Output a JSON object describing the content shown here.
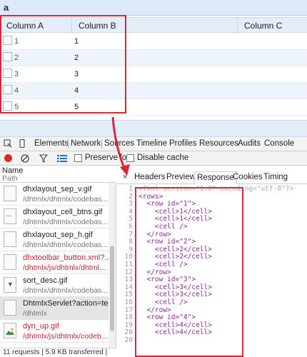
{
  "grid": {
    "title": "a",
    "columns": [
      "Column A",
      "Column B",
      "Column C"
    ],
    "rows": [
      {
        "a": "1",
        "b": "1"
      },
      {
        "a": "2",
        "b": "2"
      },
      {
        "a": "3",
        "b": "3"
      },
      {
        "a": "4",
        "b": "4"
      },
      {
        "a": "5",
        "b": "5"
      }
    ]
  },
  "devtools": {
    "tabs": [
      "Elements",
      "Network",
      "Sources",
      "Timeline",
      "Profiles",
      "Resources",
      "Audits",
      "Console"
    ],
    "active_tab": "Network",
    "toolbar": {
      "preserve_log": "Preserve log",
      "disable_cache": "Disable cache"
    },
    "left_header": {
      "name": "Name",
      "path": "Path"
    },
    "requests": [
      {
        "name": "dhxlayout_sep_v.gif",
        "path": "/dhtmlx/dhtmlx/codebas..."
      },
      {
        "name": "dhxlayout_cell_btns.gif",
        "path": "/dhtmlx/dhtmlx/codebas..."
      },
      {
        "name": "dhxlayout_sep_h.gif",
        "path": "/dhtmlx/dhtmlx/codebas..."
      },
      {
        "name": "dhxtoolbar_button.xml?...",
        "path": "/dhtmlx/js/dhtmlx/dhtml..."
      },
      {
        "name": "sort_desc.gif",
        "path": "/dhtmlx/dhtmlx/codebas..."
      },
      {
        "name": "DhtmlxServlet?action=te...",
        "path": "/dhtmlx"
      },
      {
        "name": "dyn_up.gif",
        "path": "/dhtmlx/js/dhtmlx/codeb..."
      }
    ],
    "status": "11 requests | 5.9 KB transferred | 18...",
    "detail_tabs": [
      "Headers",
      "Preview",
      "Response",
      "Cookies",
      "Timing"
    ],
    "active_detail_tab": "Response",
    "close_label": "×",
    "response_lines": [
      "<?xml version=\"1.0\" encoding=\"utf-8\"?>",
      "<rows>",
      "  <row id=\"1\">",
      "    <cell>1</cell>",
      "    <cell>1</cell>",
      "    <cell />",
      "  </row>",
      "  <row id=\"2\">",
      "    <cell>2</cell>",
      "    <cell>2</cell>",
      "    <cell />",
      "  </row>",
      "  <row id=\"3\">",
      "    <cell>3</cell>",
      "    <cell>3</cell>",
      "    <cell />",
      "  </row>",
      "  <row id=\"4\">",
      "    <cell>4</cell>",
      "    <cell>4</cell>"
    ],
    "line_numbers": [
      "1",
      "2",
      "3",
      "4",
      "5",
      "6",
      "7",
      "8",
      "9",
      "10",
      "11",
      "12",
      "13",
      "14",
      "15",
      "16",
      "17",
      "18",
      "19",
      "20"
    ]
  },
  "colors": {
    "highlight": "#d9263b",
    "record": "#e02828",
    "xml": "#8a2b8e"
  }
}
